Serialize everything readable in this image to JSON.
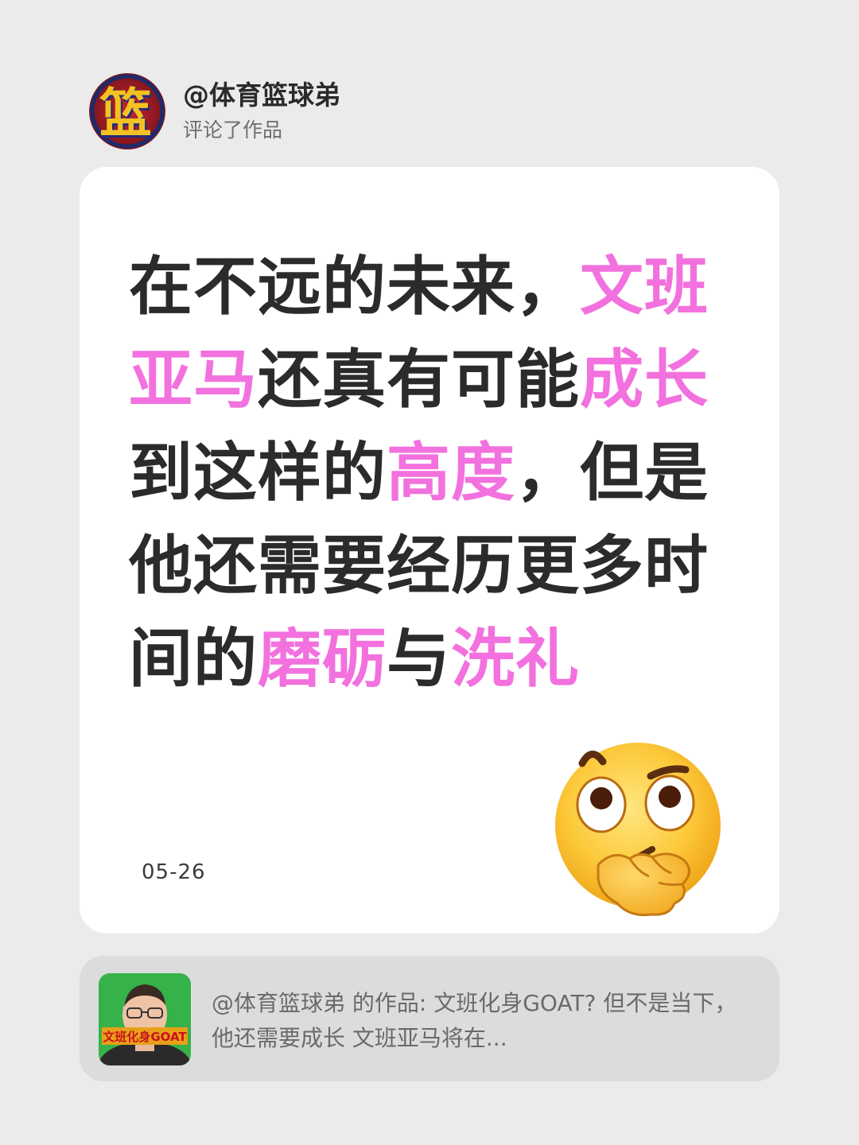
{
  "author": {
    "avatar_char": "篮",
    "name": "@体育篮球弟",
    "action": "评论了作品"
  },
  "comment": {
    "segments": [
      {
        "text": "在不远的未来，",
        "highlight": false
      },
      {
        "text": "文班亚马",
        "highlight": true
      },
      {
        "text": "还真有可能",
        "highlight": false
      },
      {
        "text": "成长",
        "highlight": true
      },
      {
        "text": "到这样的",
        "highlight": false
      },
      {
        "text": "高度",
        "highlight": true
      },
      {
        "text": "，但是他还需要经历更多时间的",
        "highlight": false
      },
      {
        "text": "磨砺",
        "highlight": true
      },
      {
        "text": "与",
        "highlight": false
      },
      {
        "text": "洗礼",
        "highlight": true
      }
    ],
    "date": "05-26",
    "emoji": "thinking-face-icon"
  },
  "reference": {
    "thumbnail_caption": "文班化身GOAT",
    "text": "@体育篮球弟 的作品: 文班化身GOAT? 但不是当下，他还需要成长 文班亚马将在..."
  },
  "colors": {
    "background": "#ebebeb",
    "card": "#ffffff",
    "highlight": "#f271de",
    "text": "#2b2b2b",
    "reference_bg": "#dcdcdc"
  }
}
